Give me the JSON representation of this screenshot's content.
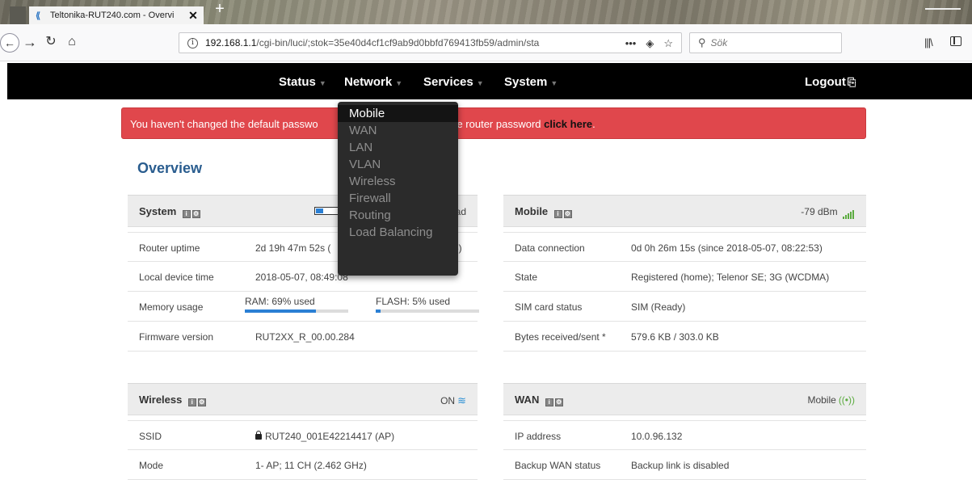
{
  "browser": {
    "tab_title": "Teltonika-RUT240.com - Overvi",
    "tab_close": "✕",
    "new_tab": "+",
    "url_host": "192.168.1.1",
    "url_path": "/cgi-bin/luci/;stok=35e40d4cf1cf9ab9d0bbfd769413fb59/admin/sta",
    "url_actions": "•••",
    "search_placeholder": "Sök"
  },
  "nav": {
    "items": [
      "Status",
      "Network",
      "Services",
      "System"
    ],
    "caret": "▼",
    "logout": "Logout"
  },
  "alert": {
    "text_start": "You haven't changed the default passwo",
    "text_end": "nge router password ",
    "link": "click here",
    "period": "."
  },
  "page_title": "Overview",
  "system_panel": {
    "title": "System",
    "right_text": "oad",
    "load_fraction": 0.22,
    "rows": {
      "uptime_label": "Router uptime",
      "uptime_value": "2d 19h 47m 52s (",
      "uptime_value_tail": "5)",
      "time_label": "Local device time",
      "time_value": "2018-05-07, 08:49:08",
      "memory_label": "Memory usage",
      "ram_label": "RAM: 69% used",
      "ram_fraction": 0.69,
      "flash_label": "FLASH: 5% used",
      "flash_fraction": 0.05,
      "firmware_label": "Firmware version",
      "firmware_value": "RUT2XX_R_00.00.284"
    }
  },
  "mobile_panel": {
    "title": "Mobile",
    "signal": "-79 dBm",
    "rows": {
      "conn_label": "Data connection",
      "conn_value": "0d 0h 26m 15s (since 2018-05-07, 08:22:53)",
      "state_label": "State",
      "state_value": "Registered (home); Telenor SE; 3G (WCDMA)",
      "sim_label": "SIM card status",
      "sim_value": "SIM (Ready)",
      "bytes_label": "Bytes received/sent *",
      "bytes_value": "579.6 KB / 303.0 KB"
    }
  },
  "wireless_panel": {
    "title": "Wireless",
    "status": "ON",
    "rows": {
      "ssid_label": "SSID",
      "ssid_value": "RUT240_001E42214417 (AP)",
      "mode_label": "Mode",
      "mode_value": "1- AP; 11 CH (2.462 GHz)"
    }
  },
  "wan_panel": {
    "title": "WAN",
    "status": "Mobile",
    "rows": {
      "ip_label": "IP address",
      "ip_value": "10.0.96.132",
      "backup_label": "Backup WAN status",
      "backup_value": "Backup link is disabled"
    }
  },
  "network_dropdown": [
    "Mobile",
    "WAN",
    "LAN",
    "VLAN",
    "Wireless",
    "Firewall",
    "Routing",
    "Load Balancing"
  ],
  "colors": {
    "nav_bg": "#000000",
    "alert_bg": "#e0474c",
    "title_blue": "#2a5d8f",
    "progress_blue": "#2a7fd4",
    "signal_green": "#5bab3f"
  }
}
